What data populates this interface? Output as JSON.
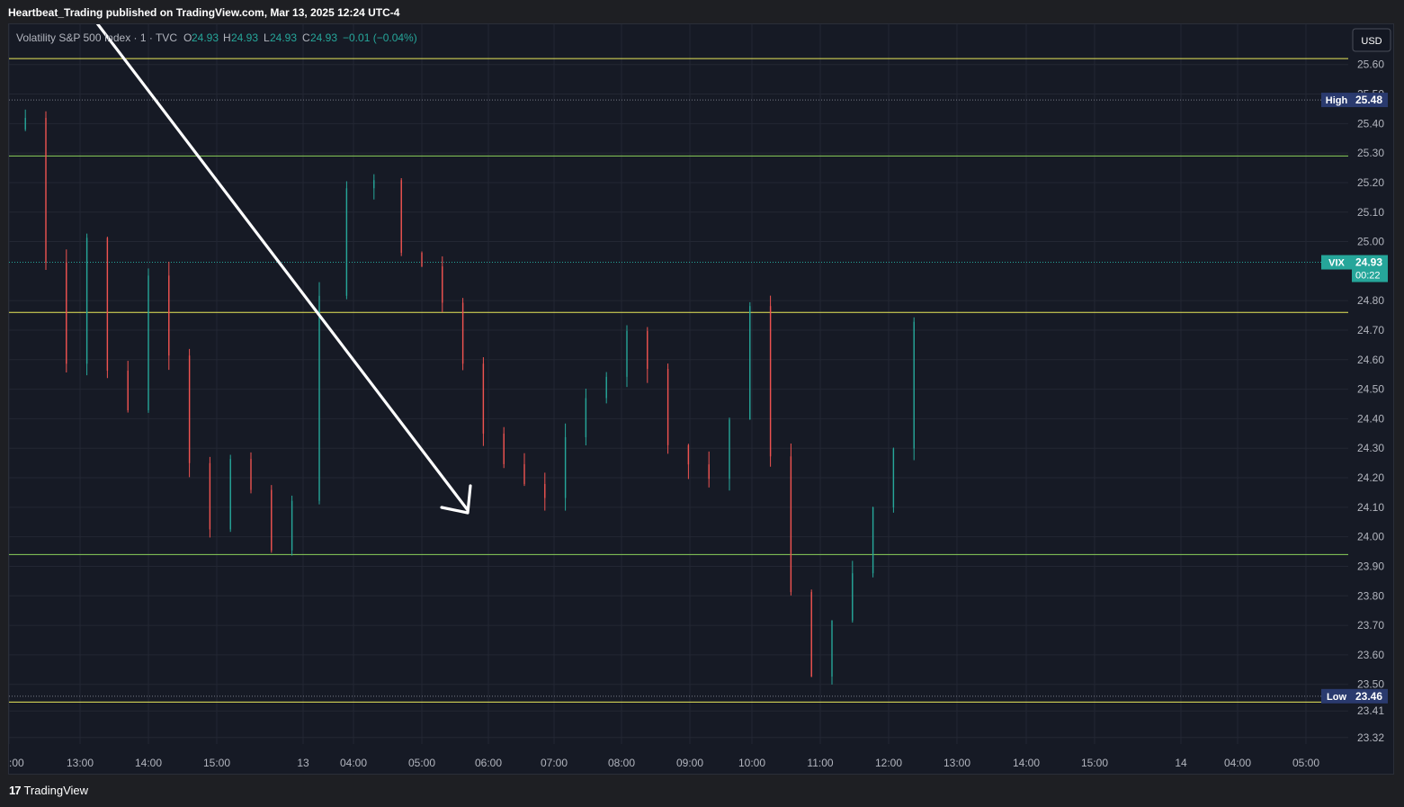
{
  "header": {
    "publisher": "Heartbeat_Trading published on TradingView.com, Mar 13, 2025 12:24 UTC-4"
  },
  "legend": {
    "symbol": "Volatility S&P 500 Index · 1 · TVC",
    "o_label": "O",
    "o_value": "24.93",
    "h_label": "H",
    "h_value": "24.93",
    "l_label": "L",
    "l_value": "24.93",
    "c_label": "C",
    "c_value": "24.93",
    "change": "−0.01 (−0.04%)"
  },
  "currency_button": "USD",
  "footer": {
    "brand": "TradingView",
    "logo_icon": "tradingview-logo-icon"
  },
  "colors": {
    "background": "#161a25",
    "up": "#26a69a",
    "down": "#ef5350",
    "level_yellow": "#e9e85a",
    "level_green": "#8bd05a",
    "vix_badge": "#26a69a",
    "high_low_badge": "#2a3a6e"
  },
  "chart_data": {
    "type": "candlestick",
    "timeframe": "1",
    "y_range": [
      23.28,
      25.68
    ],
    "y_ticks": [
      "25.60",
      "25.50",
      "25.40",
      "25.30",
      "25.20",
      "25.10",
      "25.00",
      "24.80",
      "24.70",
      "24.60",
      "24.50",
      "24.40",
      "24.30",
      "24.20",
      "24.10",
      "24.00",
      "23.90",
      "23.80",
      "23.70",
      "23.60",
      "23.50",
      "23.41",
      "23.32"
    ],
    "x_ticks": [
      ":00",
      "13:00",
      "14:00",
      "15:00",
      "13",
      "04:00",
      "05:00",
      "06:00",
      "07:00",
      "08:00",
      "09:00",
      "10:00",
      "11:00",
      "12:00",
      "13:00",
      "14:00",
      "15:00",
      "14",
      "04:00",
      "05:00"
    ],
    "horizontal_levels": [
      {
        "price": 25.62,
        "color": "yellow"
      },
      {
        "price": 25.29,
        "color": "green"
      },
      {
        "price": 24.76,
        "color": "yellow"
      },
      {
        "price": 23.94,
        "color": "green"
      },
      {
        "price": 23.44,
        "color": "yellow"
      }
    ],
    "high": {
      "label": "High",
      "value": "25.48"
    },
    "low": {
      "label": "Low",
      "value": "23.46"
    },
    "last_price": {
      "label": "VIX",
      "value": "24.93",
      "countdown": "00:22"
    },
    "price_path": [
      [
        0,
        25.38
      ],
      [
        0.02,
        25.42
      ],
      [
        0.05,
        24.95
      ],
      [
        0.08,
        24.62
      ],
      [
        0.11,
        25.02
      ],
      [
        0.14,
        24.55
      ],
      [
        0.17,
        24.45
      ],
      [
        0.2,
        24.88
      ],
      [
        0.23,
        24.65
      ],
      [
        0.26,
        24.28
      ],
      [
        0.29,
        24.05
      ],
      [
        0.32,
        24.25
      ],
      [
        0.35,
        24.12
      ],
      [
        0.38,
        23.95
      ],
      [
        0.41,
        24.1
      ],
      [
        0.45,
        24.85
      ],
      [
        0.49,
        25.15
      ],
      [
        0.53,
        25.2
      ],
      [
        0.57,
        24.95
      ],
      [
        0.6,
        24.92
      ],
      [
        0.63,
        24.8
      ],
      [
        0.66,
        24.55
      ],
      [
        0.69,
        24.35
      ],
      [
        0.72,
        24.25
      ],
      [
        0.75,
        24.2
      ],
      [
        0.78,
        24.15
      ],
      [
        0.81,
        24.3
      ],
      [
        0.84,
        24.45
      ],
      [
        0.87,
        24.58
      ],
      [
        0.9,
        24.72
      ],
      [
        0.93,
        24.55
      ],
      [
        0.96,
        24.35
      ],
      [
        0.99,
        24.25
      ],
      [
        1.02,
        24.2
      ],
      [
        1.05,
        24.4
      ],
      [
        1.08,
        24.75
      ],
      [
        1.11,
        24.3
      ],
      [
        1.14,
        23.8
      ],
      [
        1.17,
        23.5
      ],
      [
        1.2,
        23.75
      ],
      [
        1.23,
        23.85
      ],
      [
        1.26,
        24.1
      ],
      [
        1.29,
        24.3
      ],
      [
        1.32,
        24.75
      ],
      [
        1.35,
        24.55
      ],
      [
        1.38,
        24.95
      ],
      [
        1.41,
        24.68
      ],
      [
        1.44,
        24.9
      ],
      [
        1.45,
        24.93
      ]
    ],
    "annotation": {
      "type": "arrow",
      "direction": "down-right"
    }
  }
}
